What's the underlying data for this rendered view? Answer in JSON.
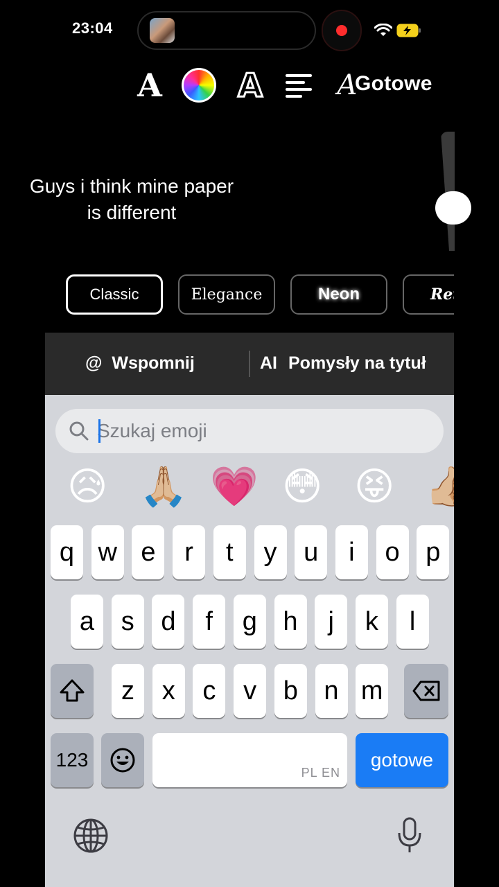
{
  "status_bar": {
    "time": "23:04",
    "recording_color": "#ff2d2d"
  },
  "toolbar": {
    "font_icon": "A",
    "color_icon": "color-wheel-icon",
    "style_icon": "A",
    "align_icon": "align-left-icon",
    "ai_icon": "A",
    "done_label": "Gotowe"
  },
  "caption": {
    "line1": "Guys i think mine paper",
    "line2": "is different"
  },
  "text_styles": [
    {
      "label": "Classic"
    },
    {
      "label": "Elegance"
    },
    {
      "label": "Neon"
    },
    {
      "label": "Ret"
    }
  ],
  "suggestions": {
    "mention_icon": "@",
    "mention_label": "Wspomnij",
    "ai_icon": "AI",
    "ai_label": "Pomysły na tytuł"
  },
  "keyboard": {
    "search_placeholder": "Szukaj emoji",
    "emojis": [
      "😥",
      "🙏🏼",
      "💗",
      "😳",
      "😝",
      "👍🏼"
    ],
    "row1": [
      "q",
      "w",
      "e",
      "r",
      "t",
      "y",
      "u",
      "i",
      "o",
      "p"
    ],
    "row2": [
      "a",
      "s",
      "d",
      "f",
      "g",
      "h",
      "j",
      "k",
      "l"
    ],
    "row3": [
      "z",
      "x",
      "c",
      "v",
      "b",
      "n",
      "m"
    ],
    "numbers_label": "123",
    "space_lang": "PL EN",
    "return_label": "gotowe",
    "accent_color": "#1a7cf5"
  }
}
